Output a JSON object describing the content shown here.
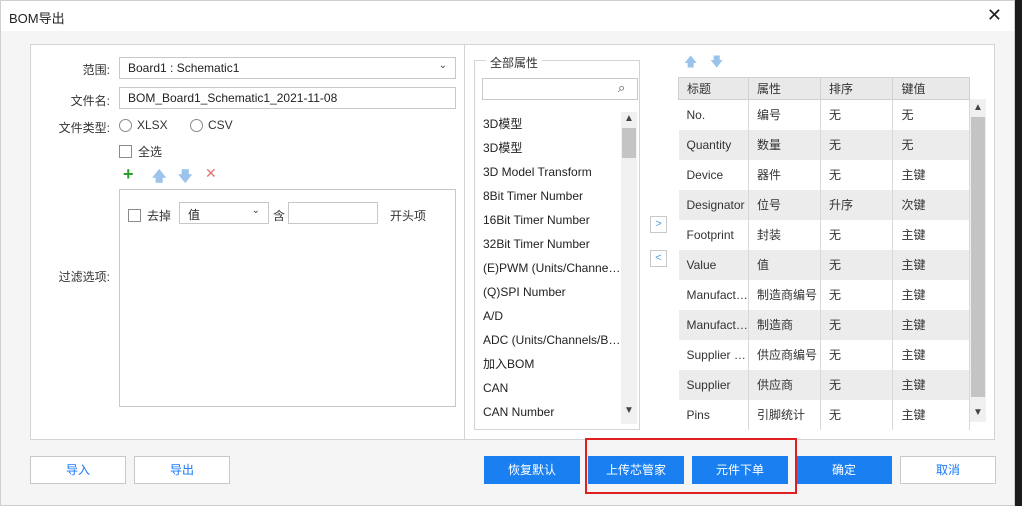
{
  "window": {
    "title": "BOM导出"
  },
  "form": {
    "scope_label": "范围:",
    "scope_value": "Board1 : Schematic1",
    "filename_label": "文件名:",
    "filename_value": "BOM_Board1_Schematic1_2021-11-08",
    "filetype_label": "文件类型:",
    "filetype_options": [
      "XLSX",
      "CSV"
    ],
    "select_all_label": "全选",
    "filter_label": "过滤选项:",
    "filter_row": {
      "remove_label": "去掉",
      "field_value": "值",
      "contains_label": "含",
      "contains_value": "",
      "suffix_label": "开头项"
    }
  },
  "attributes": {
    "legend": "全部属性",
    "search_placeholder": "",
    "items": [
      "3D模型",
      "3D模型",
      "3D Model Transform",
      "8Bit Timer Number",
      "16Bit Timer Number",
      "32Bit Timer Number",
      "(E)PWM (Units/Channels)",
      "(Q)SPI Number",
      "A/D",
      "ADC (Units/Channels/Bits)",
      "加入BOM",
      "CAN",
      "CAN Number"
    ]
  },
  "table": {
    "headers": [
      "标题",
      "属性",
      "排序",
      "键值"
    ],
    "rows": [
      [
        "No.",
        "编号",
        "无",
        "无"
      ],
      [
        "Quantity",
        "数量",
        "无",
        "无"
      ],
      [
        "Device",
        "器件",
        "无",
        "主键"
      ],
      [
        "Designator",
        "位号",
        "升序",
        "次键"
      ],
      [
        "Footprint",
        "封装",
        "无",
        "主键"
      ],
      [
        "Value",
        "值",
        "无",
        "主键"
      ],
      [
        "Manufacturer Part",
        "制造商编号",
        "无",
        "主键"
      ],
      [
        "Manufacturer",
        "制造商",
        "无",
        "主键"
      ],
      [
        "Supplier Part",
        "供应商编号",
        "无",
        "主键"
      ],
      [
        "Supplier",
        "供应商",
        "无",
        "主键"
      ],
      [
        "Pins",
        "引脚统计",
        "无",
        "主键"
      ]
    ]
  },
  "buttons": {
    "import": "导入",
    "export": "导出",
    "restore_default": "恢复默认",
    "upload_lcsc": "上传芯管家",
    "order_parts": "元件下单",
    "ok": "确定",
    "cancel": "取消"
  },
  "colors": {
    "primary": "#1a7ff0",
    "highlight": "#e02020",
    "add_green": "#2a9d2a",
    "delete_red": "#e57373"
  }
}
